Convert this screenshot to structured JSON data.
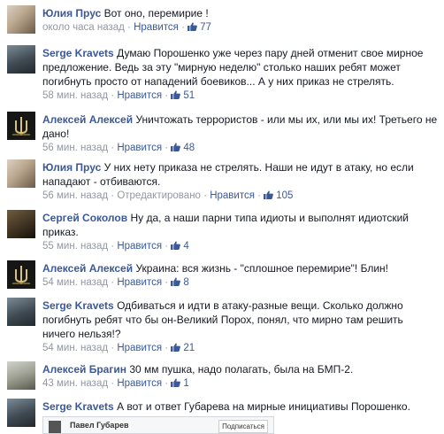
{
  "comments": [
    {
      "author": "Юлия Прус",
      "text": "Вот оно, перемирие !",
      "time": "около часа назад",
      "sep1": "·",
      "like_label": "Нравится",
      "sep2": "·",
      "likes": "77",
      "avatar": "user-photo-yulia"
    },
    {
      "author": "Serge Kravets",
      "text": "Думаю Порошенко уже через пару дней отменит свое мирное предложение. Ведь за эту \"мирную неделю\" столько наших ребят может погибнуть просто от нападений боевиков... А у них приказ не стрелять.",
      "time": "58 мин. назад",
      "sep1": "·",
      "like_label": "Нравится",
      "sep2": "·",
      "likes": "51",
      "avatar": "user-photo-serge"
    },
    {
      "author": "Алексей Алексей",
      "text": "Уничтожать террористов - или мы их, или мы их! Третьего не дано!",
      "time": "56 мин. назад",
      "sep1": "·",
      "like_label": "Нравится",
      "sep2": "·",
      "likes": "48",
      "avatar": "trident-emblem"
    },
    {
      "author": "Юлия Прус",
      "text": "У них нету приказа не стрелять. Наши не идут в атаку, но если нападают - отбиваются.",
      "time": "56 мин. назад",
      "sep1": "·",
      "edited": "Отредактировано",
      "sep_edit": "·",
      "like_label": "Нравится",
      "sep2": "·",
      "likes": "105",
      "avatar": "user-photo-yulia"
    },
    {
      "author": "Сергей Соколов",
      "text": "Ну да, а наши парни типа идиоты и выполнят идиотский приказ.",
      "time": "55 мин. назад",
      "sep1": "·",
      "like_label": "Нравится",
      "sep2": "·",
      "likes": "4",
      "avatar": "user-photo-sokolov"
    },
    {
      "author": "Алексей Алексей",
      "text": "Украина: вся жизнь - \"сплошное перемирие\"! Блин!",
      "time": "54 мин. назад",
      "sep1": "·",
      "like_label": "Нравится",
      "sep2": "·",
      "likes": "8",
      "avatar": "trident-emblem"
    },
    {
      "author": "Serge Kravets",
      "text": "Одбиваться и идти в атаку-разные вещи. Сколько должно погибнуть ребят что бы он-Великий Порох, понял, что мирно там решить ничего нельзя!?",
      "time": "54 мин. назад",
      "sep1": "·",
      "like_label": "Нравится",
      "sep2": "·",
      "likes": "21",
      "avatar": "user-photo-serge"
    },
    {
      "author": "Алексей Брагин",
      "text": "30 мм пушка, надо полагать, была на БМП-2.",
      "time": "43 мин. назад",
      "sep1": "·",
      "like_label": "Нравится",
      "sep2": "·",
      "likes": "1",
      "avatar": "user-photo-bragin"
    },
    {
      "author": "Serge Kravets",
      "text": "А вот и ответ Губарева на мирные инициативы Порошенко.",
      "avatar": "user-photo-serge"
    }
  ],
  "embed": {
    "name": "Павел Губарев",
    "subscribe_label": "Подписаться"
  },
  "colors": {
    "link": "#3b5998",
    "meta": "#9197a3",
    "text": "#141823"
  }
}
